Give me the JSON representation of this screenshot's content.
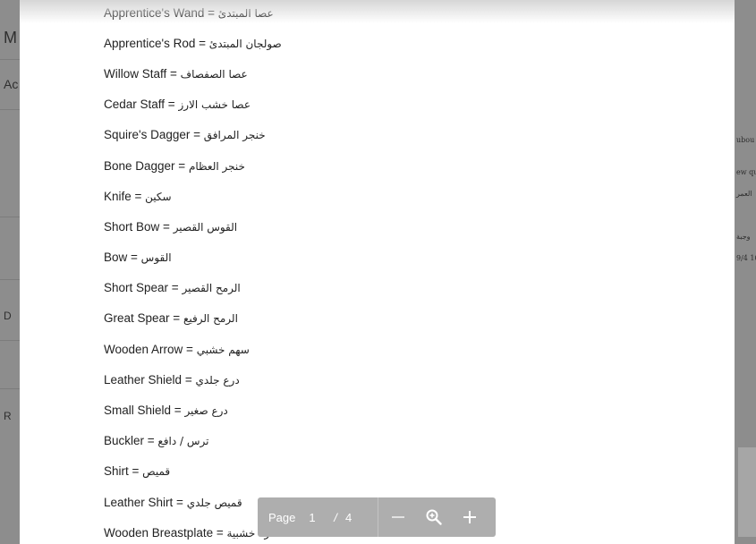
{
  "background": {
    "left_fragments": [
      "M",
      "Ac",
      "D",
      "R"
    ],
    "right_fragments": [
      "ubou",
      "ew qu",
      "العمر",
      "وجبة",
      "9/4 10"
    ]
  },
  "document": {
    "lines": [
      {
        "en": "Apprentice's Wand =",
        "ar": "عصا المبتدئ"
      },
      {
        "en": "Apprentice's Rod =",
        "ar": "صولجان المبتدئ"
      },
      {
        "en": "Willow Staff =",
        "ar": "عصا الصفصاف"
      },
      {
        "en": "Cedar Staff =",
        "ar": "عصا خشب الارز"
      },
      {
        "en": "Squire's Dagger =",
        "ar": "خنجر المرافق"
      },
      {
        "en": "Bone Dagger =",
        "ar": "خنجر العظام"
      },
      {
        "en": "Knife =",
        "ar": "سكين"
      },
      {
        "en": "Short Bow =",
        "ar": "القوس القصير"
      },
      {
        "en": "Bow =",
        "ar": "القوس"
      },
      {
        "en": "Short Spear =",
        "ar": "الرمح القصير"
      },
      {
        "en": "Great Spear =",
        "ar": "الرمح الرفيع"
      },
      {
        "en": "Wooden Arrow =",
        "ar": "سهم خشبي"
      },
      {
        "en": "Leather Shield =",
        "ar": "درع جلدي"
      },
      {
        "en": "Small Shield =",
        "ar": "درع صغير"
      },
      {
        "en": "Buckler =",
        "ar": "ترس / دافع"
      },
      {
        "en": "Shirt =",
        "ar": "قميص"
      },
      {
        "en": "Leather Shirt =",
        "ar": "قميص جلدي"
      },
      {
        "en": "Wooden Breastplate =",
        "ar": "صدرة خشبية"
      }
    ]
  },
  "toolbar": {
    "page_label": "Page",
    "current_page": "1",
    "separator": "/",
    "total_pages": "4",
    "icons": [
      "zoom-out-icon",
      "zoom-icon",
      "zoom-in-icon"
    ]
  }
}
